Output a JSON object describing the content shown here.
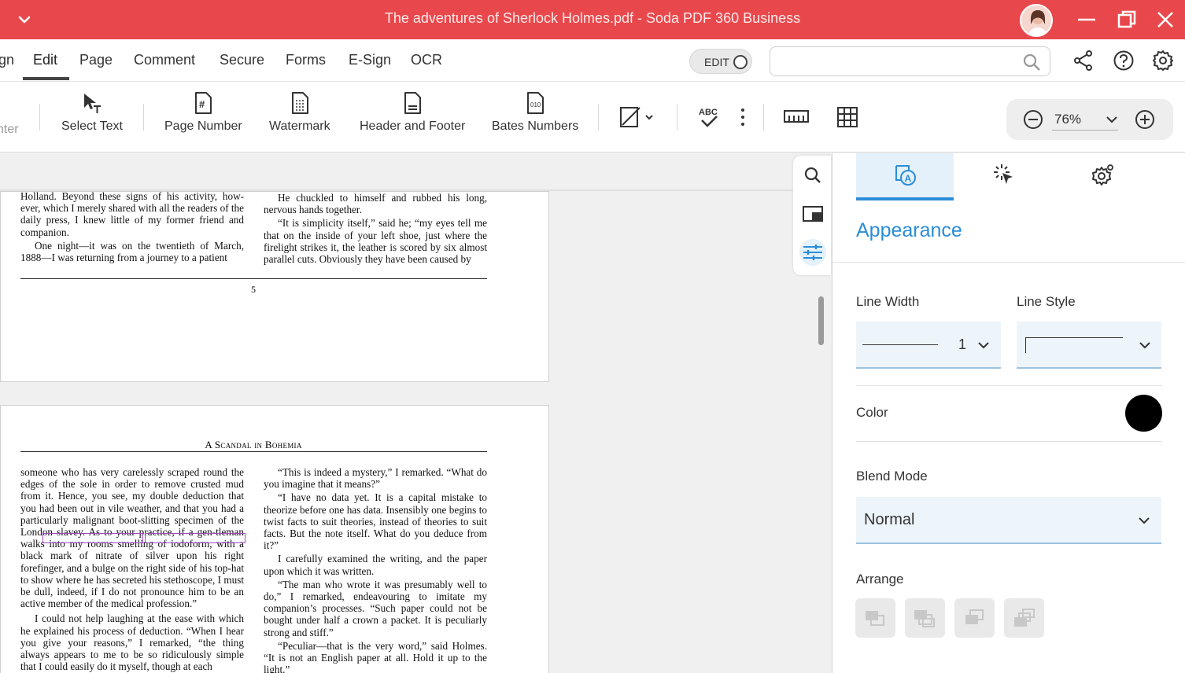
{
  "window": {
    "title": "The adventures of Sherlock Holmes.pdf   -   Soda PDF 360 Business",
    "avatar_icon": "user-avatar",
    "accent": "#e8484c"
  },
  "menu": {
    "items": [
      "gn",
      "Edit",
      "Page",
      "Comment",
      "Secure",
      "Forms",
      "E-Sign",
      "OCR"
    ],
    "active": "Edit",
    "edit_toggle_label": "EDIT",
    "search_placeholder": ""
  },
  "toolbar": {
    "cut_label": "nter",
    "select_text": "Select Text",
    "page_number": "Page Number",
    "watermark": "Watermark",
    "header_footer": "Header and Footer",
    "bates": "Bates Numbers",
    "zoom": "76%"
  },
  "document": {
    "page1": {
      "left_col": [
        "Holland. Beyond these signs of his activity, how-ever, which I merely shared with all the readers of the daily press, I knew little of my former friend and companion.",
        "One night—it was on the twentieth of March, 1888—I was returning from a journey to a patient"
      ],
      "right_col": [
        "He chuckled to himself and rubbed his long, nervous hands together.",
        "“It is simplicity itself,” said he; “my eyes tell me that on the inside of your left shoe, just where the firelight strikes it, the leather is scored by six almost parallel cuts. Obviously they have been caused by"
      ],
      "page_number": "5"
    },
    "page2": {
      "header": "A Scandal in Bohemia",
      "left_col": [
        "someone who has very carelessly scraped round the edges of the sole in order to remove crusted mud from it. Hence, you see, my double deduction that you had been out in vile weather, and that you had a particularly malignant boot-slitting specimen of the London slavey. As to your practice, if a gen-tleman walks into my rooms smelling of iodoform, with a black mark of nitrate of silver upon his right forefinger, and a bulge on the right side of his top-hat to show where he has secreted his stethoscope, I must be dull, indeed, if I do not pronounce him to be an active member of the medical profession.”",
        "I could not help laughing at the ease with which he explained his process of deduction. “When I hear you give your reasons,” I remarked, “the thing always appears to me to be so ridiculously simple that I could easily do it myself, though at each"
      ],
      "right_col": [
        "“This is indeed a mystery,” I remarked. “What do you imagine that it means?”",
        "“I have no data yet. It is a capital mistake to theorize before one has data. Insensibly one begins to twist facts to suit theories, instead of theories to suit facts. But the note itself. What do you deduce from it?”",
        "I carefully examined the writing, and the paper upon which it was written.",
        "“The man who wrote it was presumably well to do,” I remarked, endeavouring to imitate my companion’s processes. “Such paper could not be bought under half a crown a packet. It is peculiarly strong and stiff.”",
        "“Peculiar—that is the very word,” said Holmes. “It is not an English paper at all. Hold it up to the light.”"
      ]
    }
  },
  "panel": {
    "title": "Appearance",
    "line_width_label": "Line Width",
    "line_width_value": "1",
    "line_style_label": "Line Style",
    "color_label": "Color",
    "color_value": "#000000",
    "blend_label": "Blend Mode",
    "blend_value": "Normal",
    "arrange_label": "Arrange"
  }
}
